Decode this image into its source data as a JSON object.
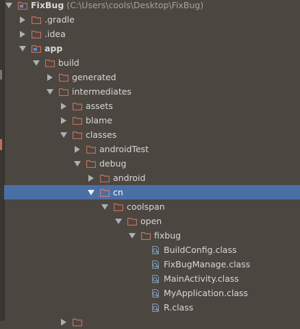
{
  "project": {
    "name": "FixBug",
    "path": "(C:\\Users\\cools\\Desktop\\FixBug)"
  },
  "tree": [
    {
      "label": ".gradle",
      "expanded": false,
      "icon": "folder-icon"
    },
    {
      "label": ".idea",
      "expanded": false,
      "icon": "folder-icon"
    },
    {
      "label": "app",
      "expanded": true,
      "icon": "module-folder-icon"
    },
    {
      "label": "build",
      "expanded": true,
      "icon": "folder-icon"
    },
    {
      "label": "generated",
      "expanded": false,
      "icon": "folder-icon"
    },
    {
      "label": "intermediates",
      "expanded": true,
      "icon": "folder-icon"
    },
    {
      "label": "assets",
      "expanded": false,
      "icon": "folder-icon"
    },
    {
      "label": "blame",
      "expanded": false,
      "icon": "folder-icon"
    },
    {
      "label": "classes",
      "expanded": true,
      "icon": "folder-icon"
    },
    {
      "label": "androidTest",
      "expanded": false,
      "icon": "folder-icon"
    },
    {
      "label": "debug",
      "expanded": true,
      "icon": "folder-icon"
    },
    {
      "label": "android",
      "expanded": false,
      "icon": "folder-icon"
    },
    {
      "label": "cn",
      "expanded": true,
      "icon": "folder-icon"
    },
    {
      "label": "coolspan",
      "expanded": true,
      "icon": "folder-icon"
    },
    {
      "label": "open",
      "expanded": true,
      "icon": "folder-icon"
    },
    {
      "label": "fixbug",
      "expanded": true,
      "icon": "folder-icon"
    },
    {
      "label": "BuildConfig.class",
      "icon": "class-file-icon"
    },
    {
      "label": "FixBugManage.class",
      "icon": "class-file-icon"
    },
    {
      "label": "MainActivity.class",
      "icon": "class-file-icon"
    },
    {
      "label": "MyApplication.class",
      "icon": "class-file-icon"
    },
    {
      "label": "R.class",
      "icon": "class-file-icon"
    }
  ],
  "colors": {
    "background": "#4b4640",
    "selection": "#4a6fa5",
    "folder": "#c9705f",
    "text": "#d8d8d8"
  }
}
